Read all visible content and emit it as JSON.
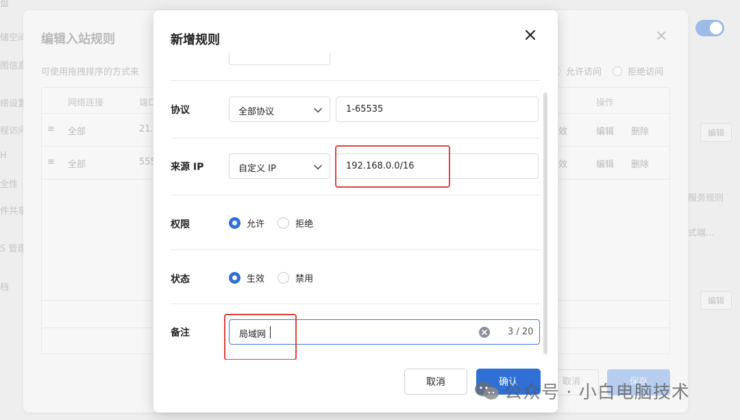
{
  "background": {
    "nav_items": [
      "盘",
      "储空间",
      "图信息",
      "络设置",
      "程访问",
      "H",
      "全性",
      "件共享",
      "S 管理",
      "档"
    ],
    "right_side": {
      "edit_button_1": "编辑",
      "service_rules": "服务规则",
      "mode_text": "式端...",
      "edit_button_2": "编辑"
    }
  },
  "back_dialog": {
    "title": "编辑入站规则",
    "description": "可使用拖拽排序的方式来",
    "radio_allow": "允许访问",
    "radio_deny": "拒绝访问",
    "columns": [
      "网络连接",
      "端口",
      "操作"
    ],
    "rows": [
      {
        "network": "全部",
        "port": "21.",
        "status": "效",
        "edit": "编辑",
        "delete": "删除"
      },
      {
        "network": "全部",
        "port": "555",
        "status": "效",
        "edit": "编辑",
        "delete": "删除"
      }
    ],
    "cancel_label": "取消",
    "save_label": "保存"
  },
  "modal": {
    "title": "新增规则",
    "protocol": {
      "label": "协议",
      "select_value": "全部协议",
      "port_value": "1-65535"
    },
    "source_ip": {
      "label": "来源 IP",
      "select_value": "自定义 IP",
      "ip_value": "192.168.0.0/16"
    },
    "permission": {
      "label": "权限",
      "options": [
        "允许",
        "拒绝"
      ],
      "selected": "允许"
    },
    "status": {
      "label": "状态",
      "options": [
        "生效",
        "禁用"
      ],
      "selected": "生效"
    },
    "note": {
      "label": "备注",
      "value": "局域网",
      "counter": "3 / 20"
    },
    "cancel_label": "取消",
    "confirm_label": "确认"
  },
  "watermark": {
    "text": "公众号 · 小白电脑技术"
  },
  "colors": {
    "accent": "#2f6fd6",
    "highlight": "#e0413a"
  }
}
